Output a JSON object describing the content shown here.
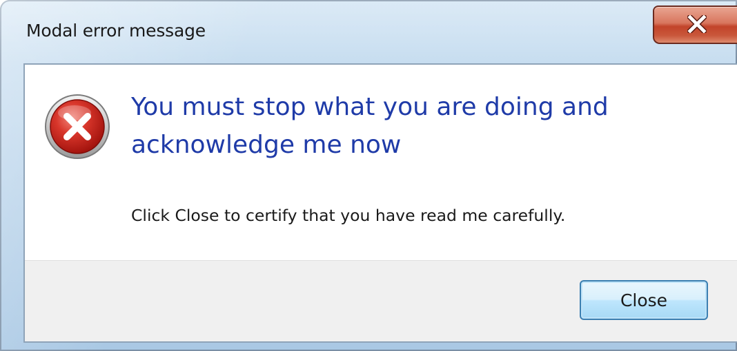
{
  "window": {
    "title": "Modal error message",
    "close_icon": "close-icon"
  },
  "message": {
    "icon": "error-icon",
    "main_instruction": "You must stop what you are doing and acknowledge me now",
    "body": "Click Close to certify that you have read me carefully."
  },
  "footer": {
    "close_label": "Close"
  },
  "colors": {
    "instruction_text": "#1f3ba8",
    "error_red": "#c2241c",
    "close_x_red": "#c2442a",
    "button_border": "#3c7fb1"
  }
}
